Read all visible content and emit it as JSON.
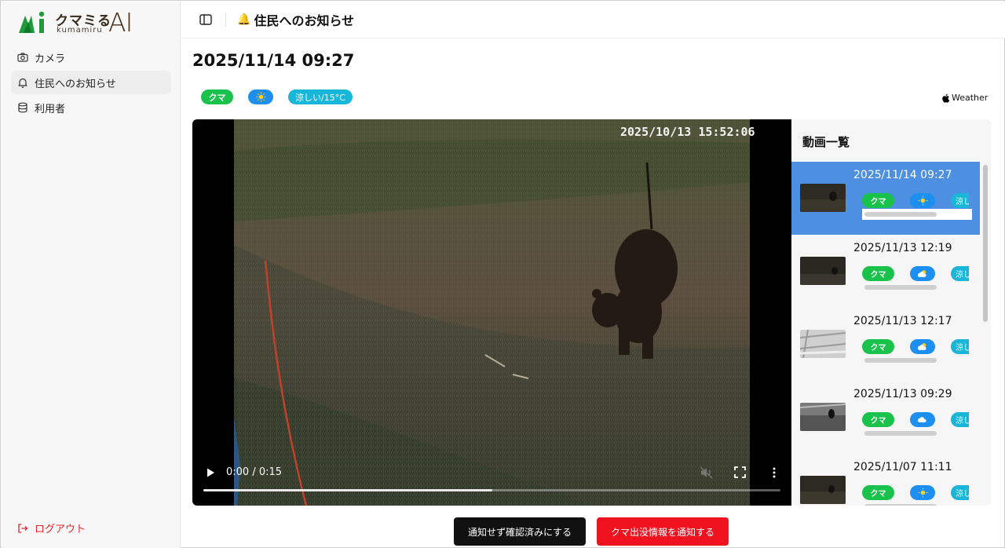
{
  "brand": {
    "kana": "クマミる",
    "sub": "kumamiru",
    "ai": "AI"
  },
  "sidebar": {
    "items": [
      {
        "label": "カメラ",
        "icon": "camera-icon",
        "active": false
      },
      {
        "label": "住民へのお知らせ",
        "icon": "bell-icon",
        "active": true
      },
      {
        "label": "利用者",
        "icon": "database-icon",
        "active": false
      }
    ],
    "logout": "ログアウト"
  },
  "header": {
    "icon": "bell-emoji-icon",
    "title": "住民へのお知らせ"
  },
  "main": {
    "datetime": "2025/11/14 09:27",
    "tags": {
      "animal": "クマ",
      "weather_icon": "☀",
      "temp": "涼しい/15°C"
    },
    "weather_attr": "Weather"
  },
  "video": {
    "overlay_timestamp": "2025/10/13  15:52:06",
    "time": "0:00 / 0:15",
    "progress": 0.5
  },
  "video_list": {
    "title": "動画一覧",
    "items": [
      {
        "date": "2025/11/14 09:27",
        "animal": "クマ",
        "weather": "sun",
        "temp": "涼し",
        "active": true
      },
      {
        "date": "2025/11/13 12:19",
        "animal": "クマ",
        "weather": "cloud-sun",
        "temp": "涼し",
        "active": false
      },
      {
        "date": "2025/11/13 12:17",
        "animal": "クマ",
        "weather": "cloud-sun",
        "temp": "涼し",
        "active": false
      },
      {
        "date": "2025/11/13 09:29",
        "animal": "クマ",
        "weather": "cloud",
        "temp": "涼し",
        "active": false
      },
      {
        "date": "2025/11/07 11:11",
        "animal": "クマ",
        "weather": "sun",
        "temp": "涼し",
        "active": false
      }
    ]
  },
  "actions": {
    "confirm_no_notify": "通知せず確認済みにする",
    "notify": "クマ出没情報を通知する"
  },
  "colors": {
    "green": "#19c24b",
    "blue": "#1d8ff0",
    "cyan": "#18b6d8",
    "active_item": "#4d8fe0",
    "danger": "#f0121e"
  }
}
